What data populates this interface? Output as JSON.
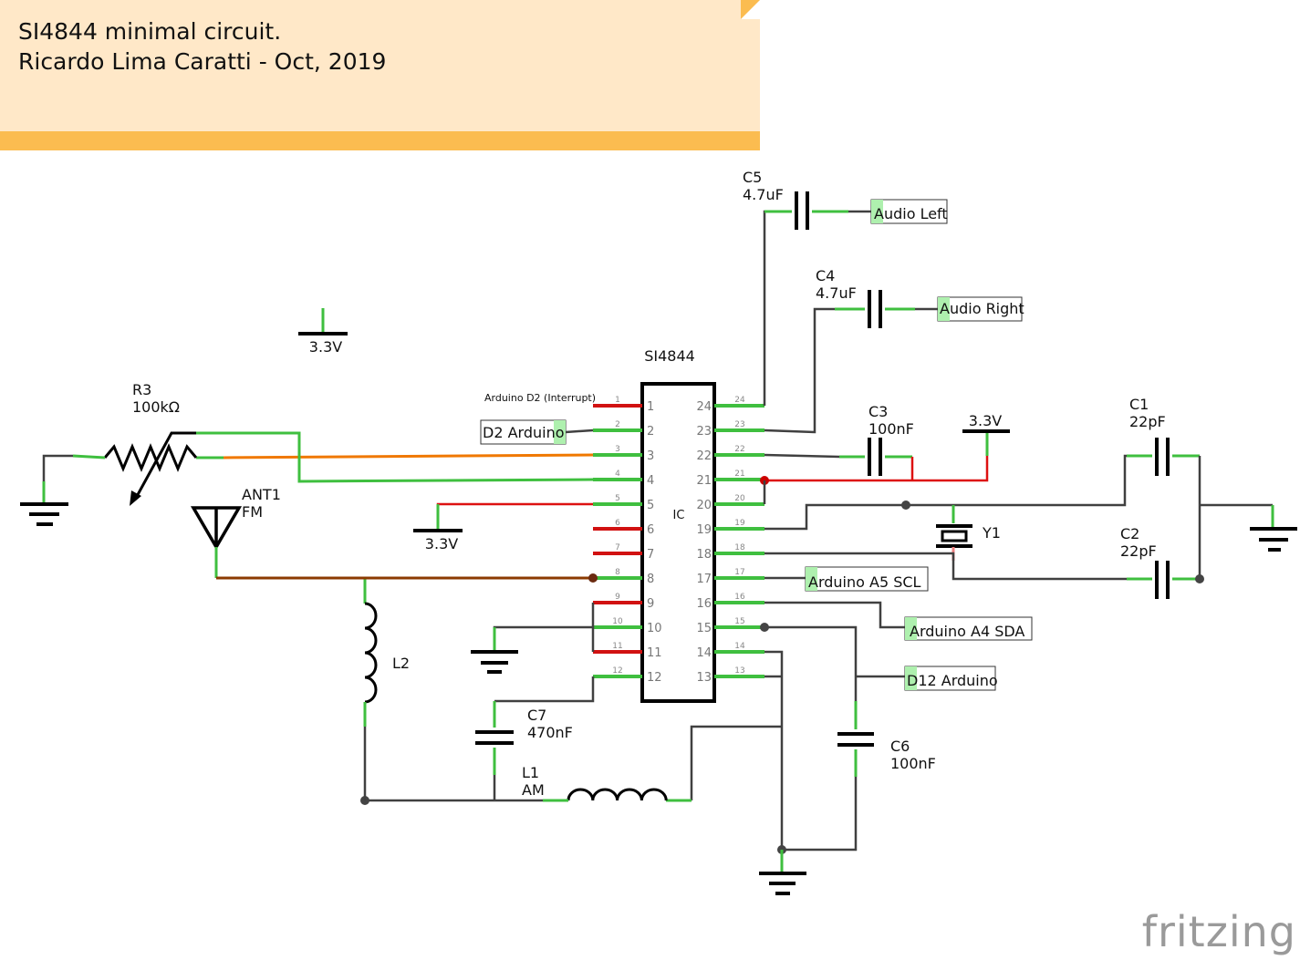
{
  "note": {
    "line1": "SI4844 minimal circuit.",
    "line2": "Ricardo Lima Caratti - Oct, 2019"
  },
  "ic": {
    "title": "SI4844",
    "label": "IC",
    "left_pins": [
      {
        "n": "1",
        "status": "unconnected"
      },
      {
        "n": "2",
        "status": "connected"
      },
      {
        "n": "3",
        "status": "connected"
      },
      {
        "n": "4",
        "status": "connected"
      },
      {
        "n": "5",
        "status": "connected"
      },
      {
        "n": "6",
        "status": "unconnected"
      },
      {
        "n": "7",
        "status": "unconnected"
      },
      {
        "n": "8",
        "status": "connected"
      },
      {
        "n": "9",
        "status": "unconnected"
      },
      {
        "n": "10",
        "status": "connected"
      },
      {
        "n": "11",
        "status": "unconnected"
      },
      {
        "n": "12",
        "status": "connected"
      }
    ],
    "right_pins": [
      "24",
      "23",
      "22",
      "21",
      "20",
      "19",
      "18",
      "17",
      "16",
      "15",
      "14",
      "13"
    ]
  },
  "components": {
    "c5": {
      "name": "C5",
      "value": "4.7uF"
    },
    "c4": {
      "name": "C4",
      "value": "4.7uF"
    },
    "c3": {
      "name": "C3",
      "value": "100nF"
    },
    "c1": {
      "name": "C1",
      "value": "22pF"
    },
    "c2": {
      "name": "C2",
      "value": "22pF"
    },
    "c6": {
      "name": "C6",
      "value": "100nF"
    },
    "c7": {
      "name": "C7",
      "value": "470nF"
    },
    "r3": {
      "name": "R3",
      "value": "100kΩ"
    },
    "ant1": {
      "name": "ANT1",
      "value": "FM"
    },
    "l1": {
      "name": "L1",
      "value": "AM"
    },
    "l2": {
      "name": "L2"
    },
    "y1": {
      "name": "Y1"
    }
  },
  "power": {
    "v1": "3.3V",
    "v2": "3.3V",
    "v3": "3.3V"
  },
  "net_labels": {
    "audio_left": "Audio Left",
    "audio_right": "Audio Right",
    "d2": "D2 Arduino",
    "a5": "Arduino A5 SCL",
    "a4": "Arduino A4 SDA",
    "d12": "D12 Arduino",
    "interrupt_note": "Arduino D2 (Interrupt)"
  },
  "colors": {
    "note_bg": "#ffe8c8",
    "note_strip": "#fbbc50",
    "connected": "#3fbf3f",
    "unconnected": "#d11111",
    "wire": "#404040",
    "orange_wire": "#f07800",
    "brown_wire": "#8b3a00"
  },
  "logo": "fritzing"
}
